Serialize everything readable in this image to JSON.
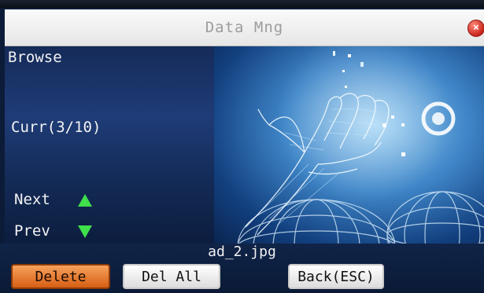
{
  "window": {
    "title": "Data Mng"
  },
  "sidebar": {
    "heading": "Browse",
    "position_label": "Curr(3/10)",
    "next_label": "Next",
    "prev_label": "Prev"
  },
  "preview": {
    "filename": "ad_2.jpg"
  },
  "buttons": {
    "delete": "Delete",
    "delete_all": "Del All",
    "back": "Back(ESC)"
  },
  "colors": {
    "accent_selected": "#e07a2e",
    "arrow": "#3fe04a",
    "close": "#d8322a"
  }
}
